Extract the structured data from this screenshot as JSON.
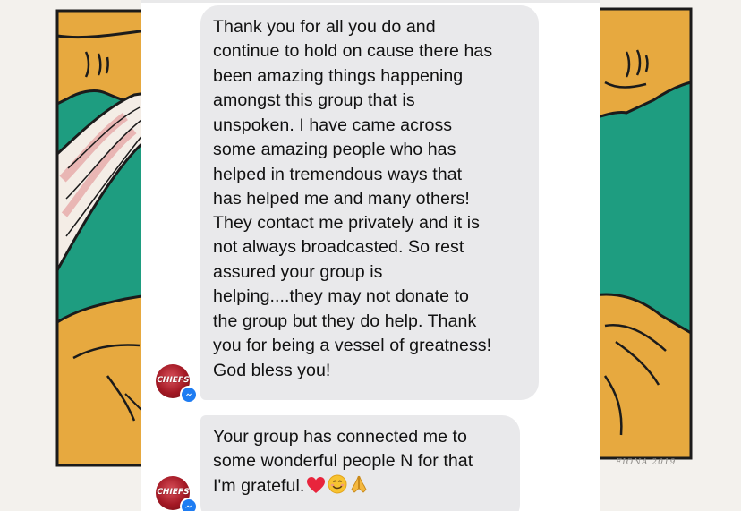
{
  "artwork": {
    "signature": "FIONA 2019",
    "colors": {
      "background": "#f3f1ed",
      "mustard": "#e7a93f",
      "teal": "#1e9d80",
      "outline": "#1b1b1b",
      "pink": "#e9b6b4"
    }
  },
  "chat": {
    "bubble_color": "#e9e9eb",
    "text_color": "#111111",
    "messages": [
      {
        "lines": [
          "Thank you for all you do and",
          "continue to hold on cause there has",
          "been amazing things happening",
          "amongst this group that is",
          "unspoken. I have came across",
          "some amazing people who has",
          "helped in tremendous ways that",
          "has helped me and many others!",
          "They contact me privately and it is",
          "not always broadcasted. So rest",
          "assured your group is",
          "helping....they may not donate to",
          "the group but they do help. Thank",
          "you for being a vessel of greatness!",
          "God bless you!"
        ]
      },
      {
        "lines": [
          "Your group has connected me to",
          "some wonderful people N for that",
          "I'm grateful."
        ],
        "emojis": [
          "heart-emoji",
          "smiling-face-emoji",
          "folded-hands-emoji"
        ]
      }
    ],
    "sender": {
      "avatar_text": "CHIEFS",
      "avatar_color": "#a31824",
      "badge": "messenger-icon",
      "badge_color": "#1e7cf2"
    }
  }
}
